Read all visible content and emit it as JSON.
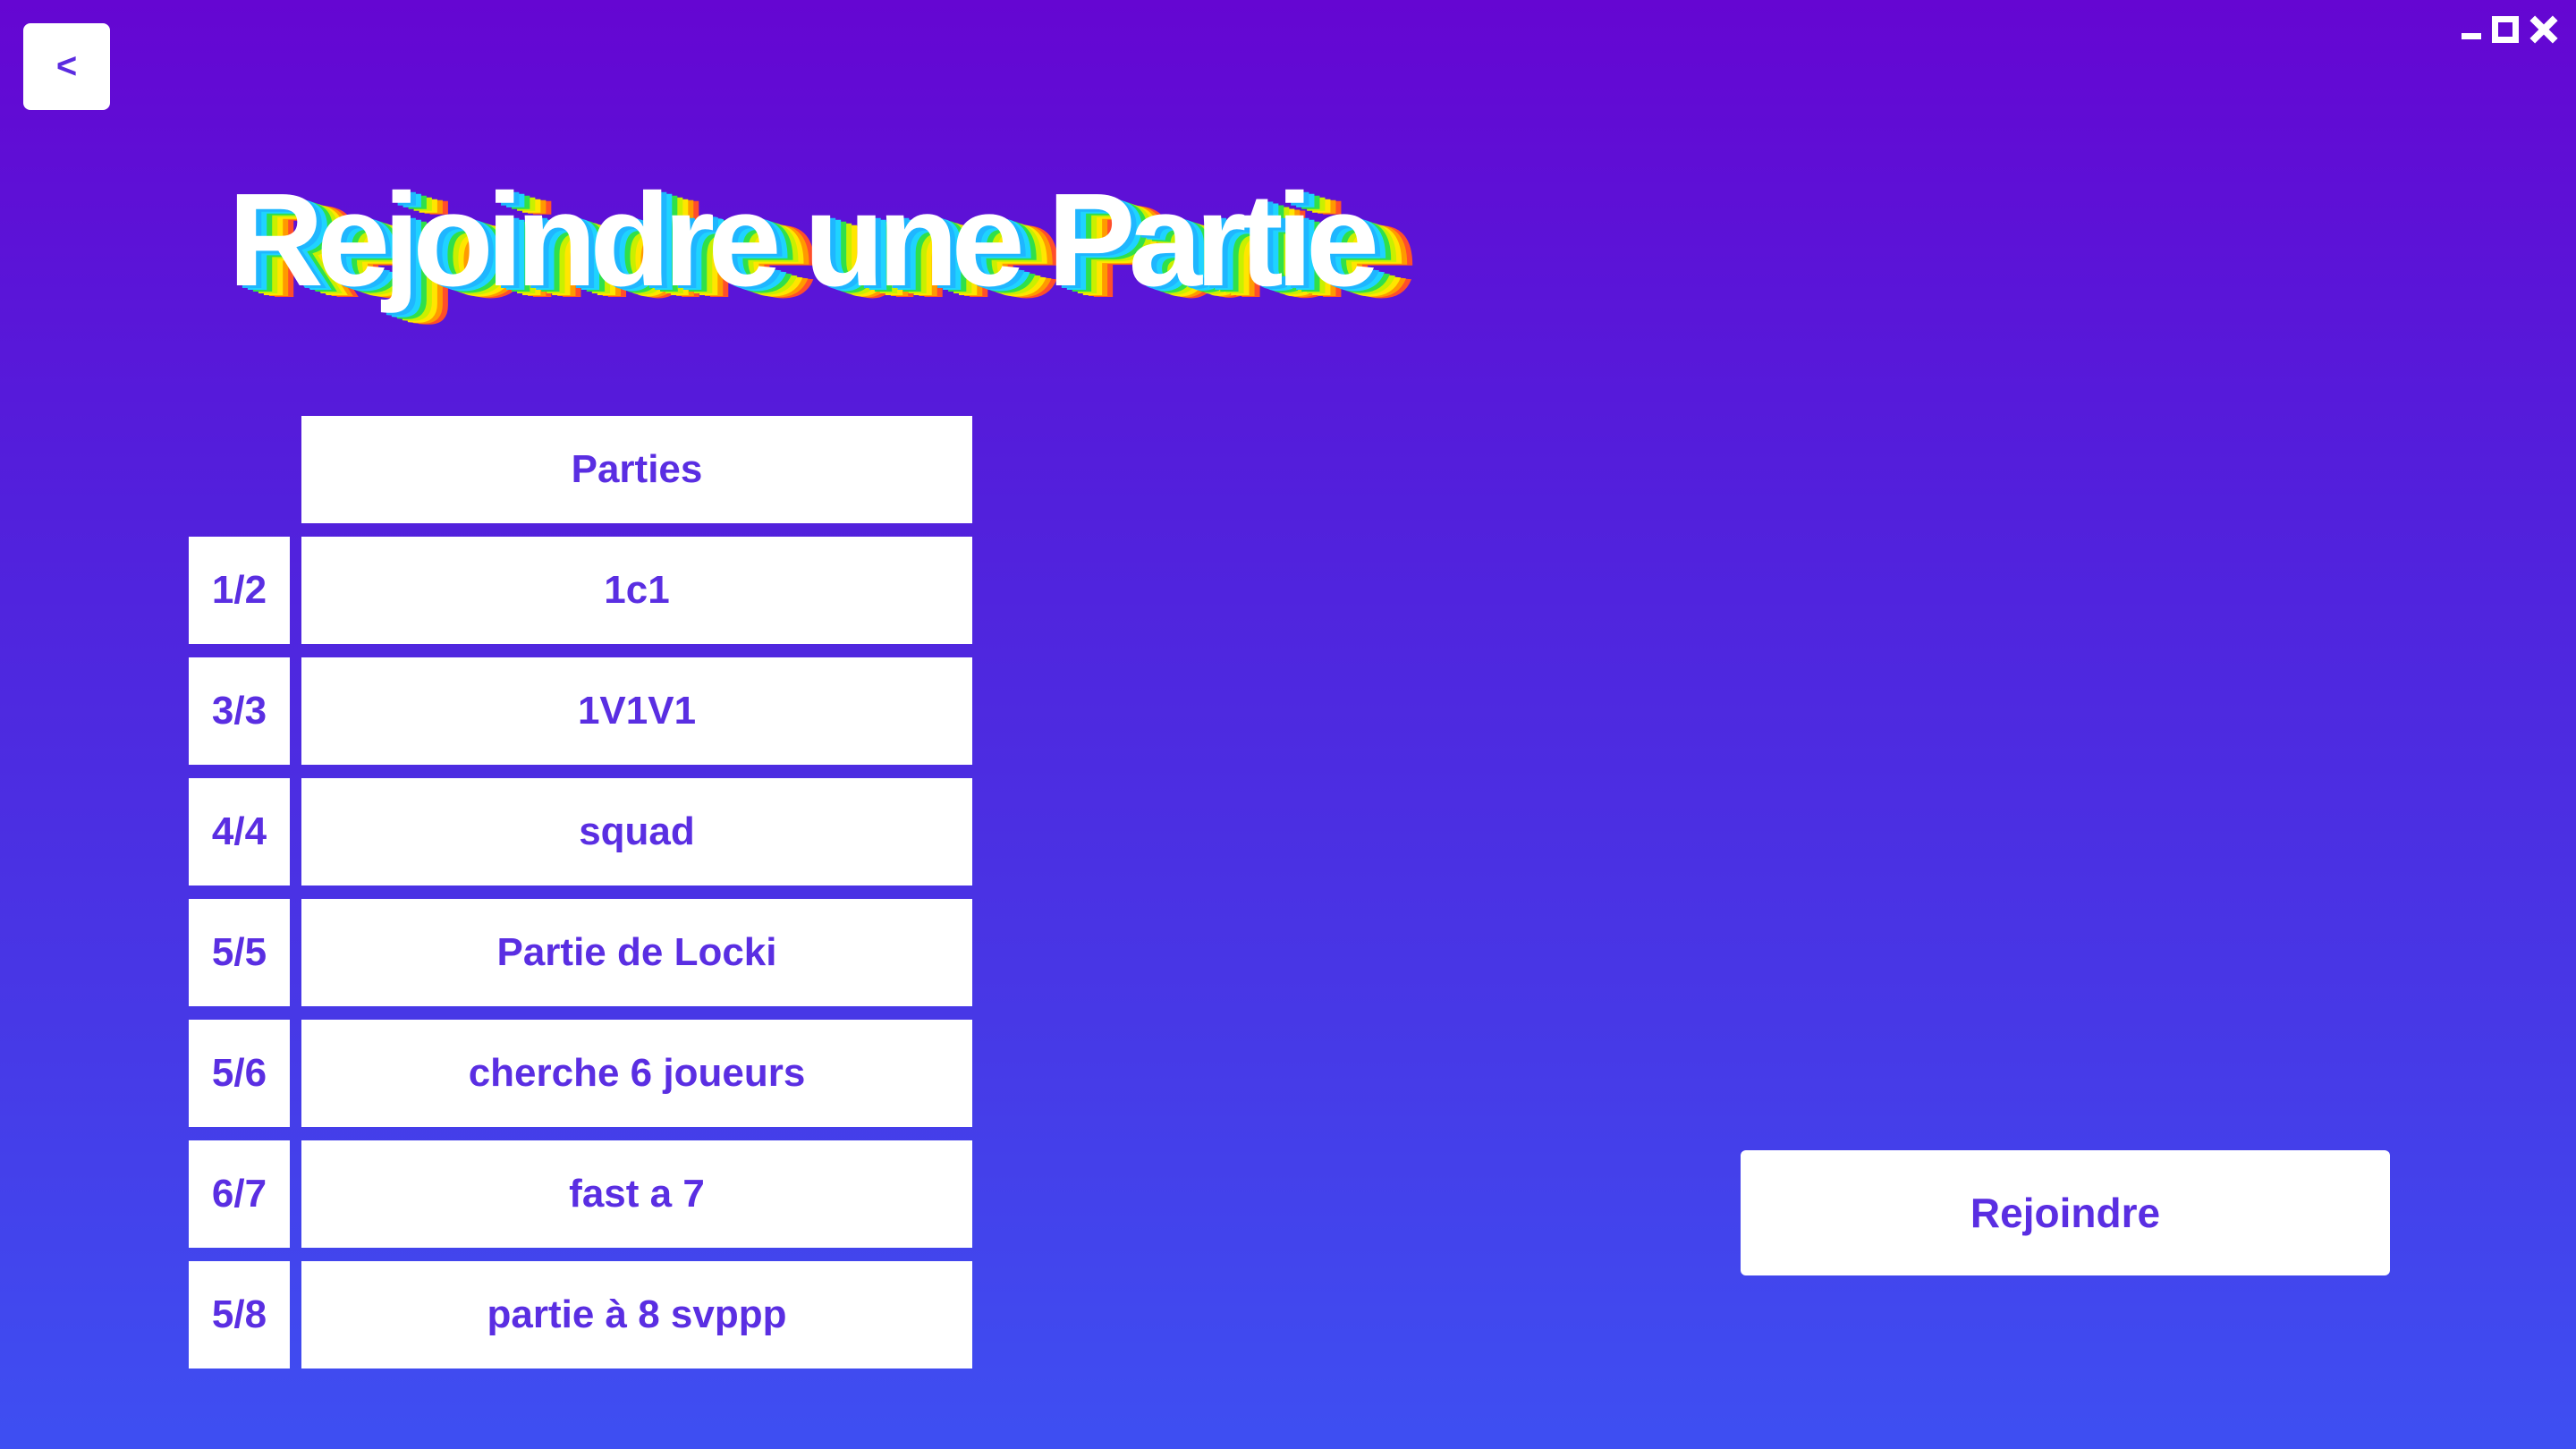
{
  "nav": {
    "back_label": "<"
  },
  "window_controls": {
    "minimize_icon": "minimize-icon",
    "maximize_icon": "maximize-icon",
    "close_icon": "close-icon"
  },
  "page": {
    "title": "Rejoindre une Partie"
  },
  "games": {
    "header": "Parties",
    "rows": [
      {
        "players": "1/2",
        "name": "1c1"
      },
      {
        "players": "3/3",
        "name": "1V1V1"
      },
      {
        "players": "4/4",
        "name": "squad"
      },
      {
        "players": "5/5",
        "name": "Partie de Locki"
      },
      {
        "players": "5/6",
        "name": "cherche 6 joueurs"
      },
      {
        "players": "6/7",
        "name": "fast a 7"
      },
      {
        "players": "5/8",
        "name": "partie à 8 svppp"
      }
    ]
  },
  "actions": {
    "join_label": "Rejoindre"
  },
  "colors": {
    "background_top": "#6506d2",
    "background_bottom": "#3e4ff2",
    "accent_text": "#5a2ee2"
  }
}
